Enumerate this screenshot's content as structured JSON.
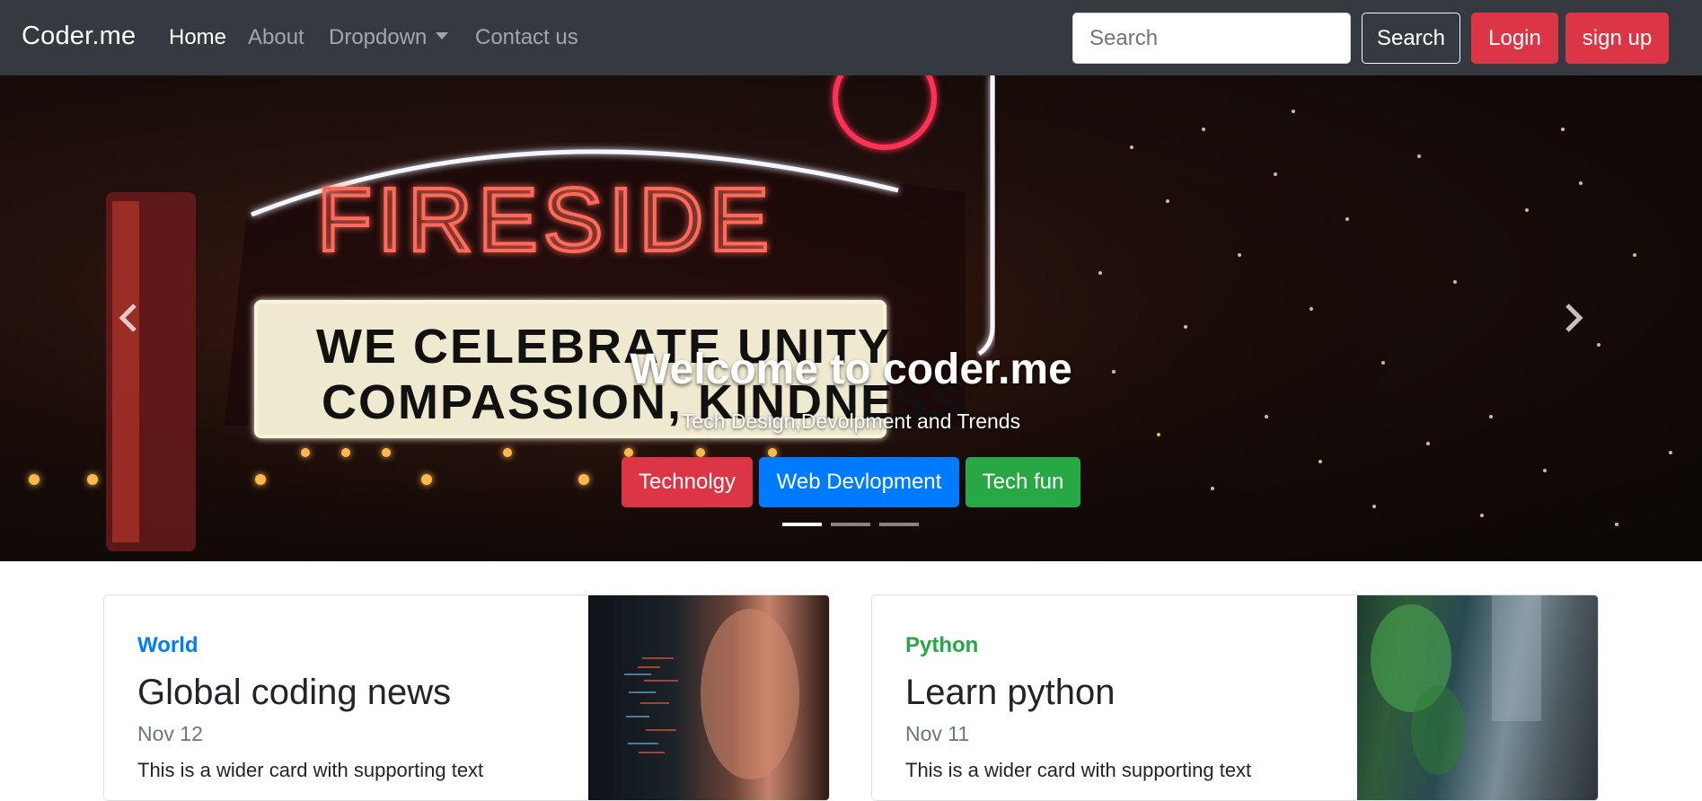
{
  "navbar": {
    "brand": "Coder.me",
    "links": [
      "Home",
      "About",
      "Dropdown",
      "Contact us"
    ],
    "search_placeholder": "Search",
    "search_button": "Search",
    "login_button": "Login",
    "signup_button": "sign up",
    "colors": {
      "background": "#343a40",
      "danger": "#dc3545"
    }
  },
  "hero": {
    "sign_word": "FIRESIDE",
    "marquee_line1": "WE CELEBRATE UNITY,",
    "marquee_line2": "COMPASSION, KINDNESS",
    "title": "Welcome to coder.me",
    "subtitle": "Tech Design,Devolpment and Trends",
    "buttons": [
      {
        "label": "Technolgy",
        "color": "#dc3545"
      },
      {
        "label": "Web Devlopment",
        "color": "#007bff"
      },
      {
        "label": "Tech fun",
        "color": "#28a745"
      }
    ],
    "slide_count": 3,
    "active_slide": 1,
    "icons": {
      "prev": "chevron-left-icon",
      "next": "chevron-right-icon"
    }
  },
  "cards": [
    {
      "category": "World",
      "category_color": "#007bff",
      "title": "Global coding news",
      "date": "Nov 12",
      "text": "This is a wider card with supporting text"
    },
    {
      "category": "Python",
      "category_color": "#28a745",
      "title": "Learn python",
      "date": "Nov 11",
      "text": "This is a wider card with supporting text"
    }
  ]
}
